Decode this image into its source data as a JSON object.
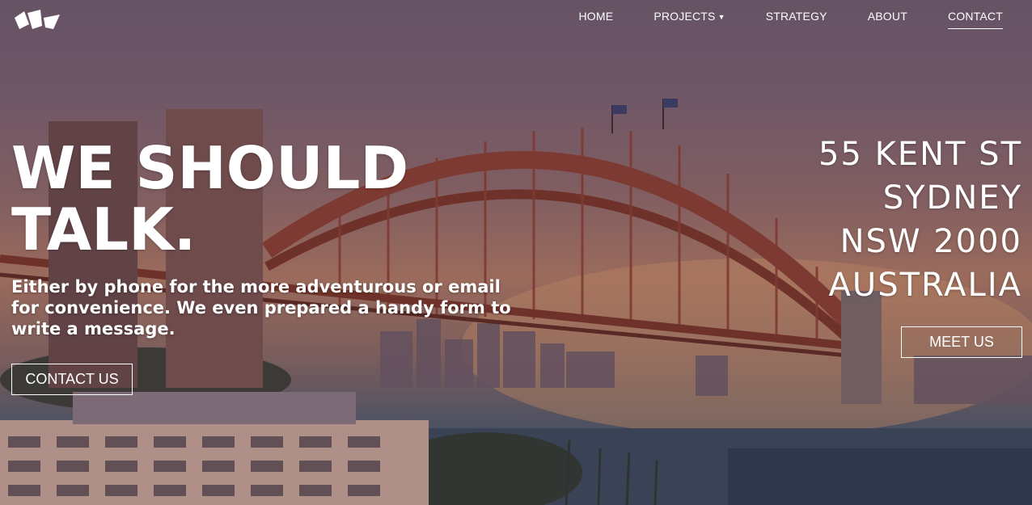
{
  "nav": {
    "logo_icon": "brand-logo-icon",
    "items": [
      {
        "label": "HOME"
      },
      {
        "label": "PROJECTS",
        "has_dropdown": true
      },
      {
        "label": "STRATEGY"
      },
      {
        "label": "ABOUT"
      },
      {
        "label": "CONTACT",
        "active": true
      }
    ]
  },
  "hero": {
    "headline_line1": "WE SHOULD",
    "headline_line2": "TALK.",
    "lead": "Either by phone for the more adventurous or email for convenience. We even prepared a handy form to write a message.",
    "contact_button": "CONTACT US",
    "address": [
      "55 KENT ST",
      "SYDNEY",
      "NSW 2000",
      "AUSTRALIA"
    ],
    "meet_button": "MEET US"
  },
  "colors": {
    "sky_top": "#6f5d6e",
    "sunset": "#b07a63",
    "bridge": "#9a4a3a",
    "water": "#2f3a48"
  }
}
